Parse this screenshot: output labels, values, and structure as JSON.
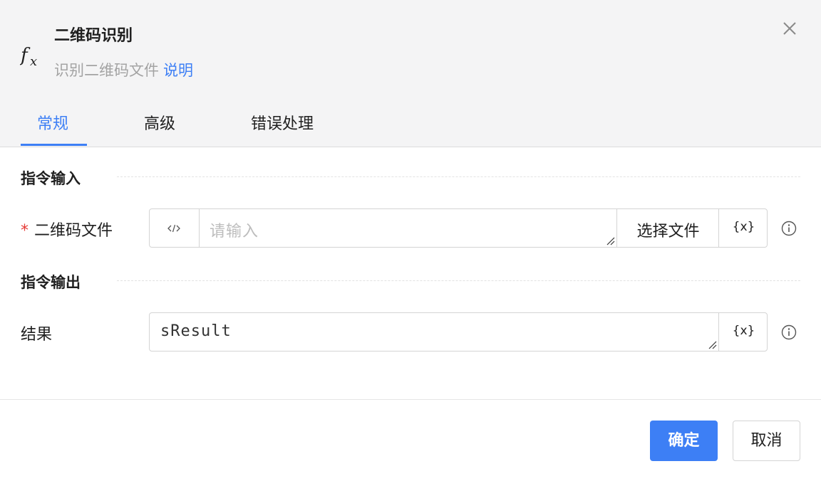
{
  "dialog": {
    "title": "二维码识别",
    "subtitle": "识别二维码文件",
    "help_link": "说明",
    "icon": "fx-icon"
  },
  "tabs": [
    {
      "label": "常规",
      "active": true
    },
    {
      "label": "高级",
      "active": false
    },
    {
      "label": "错误处理",
      "active": false
    }
  ],
  "input_section": {
    "title": "指令输入",
    "fields": [
      {
        "required_mark": "*",
        "label": "二维码文件",
        "value": "",
        "placeholder": "请输入",
        "select_file_button": "选择文件",
        "variable_button": "{x}"
      }
    ]
  },
  "output_section": {
    "title": "指令输出",
    "fields": [
      {
        "label": "结果",
        "value": "sResult",
        "variable_button": "{x}"
      }
    ]
  },
  "footer": {
    "confirm": "确定",
    "cancel": "取消"
  },
  "colors": {
    "accent": "#3d7ff5",
    "required": "#e53935",
    "header_bg": "#f4f4f5"
  }
}
